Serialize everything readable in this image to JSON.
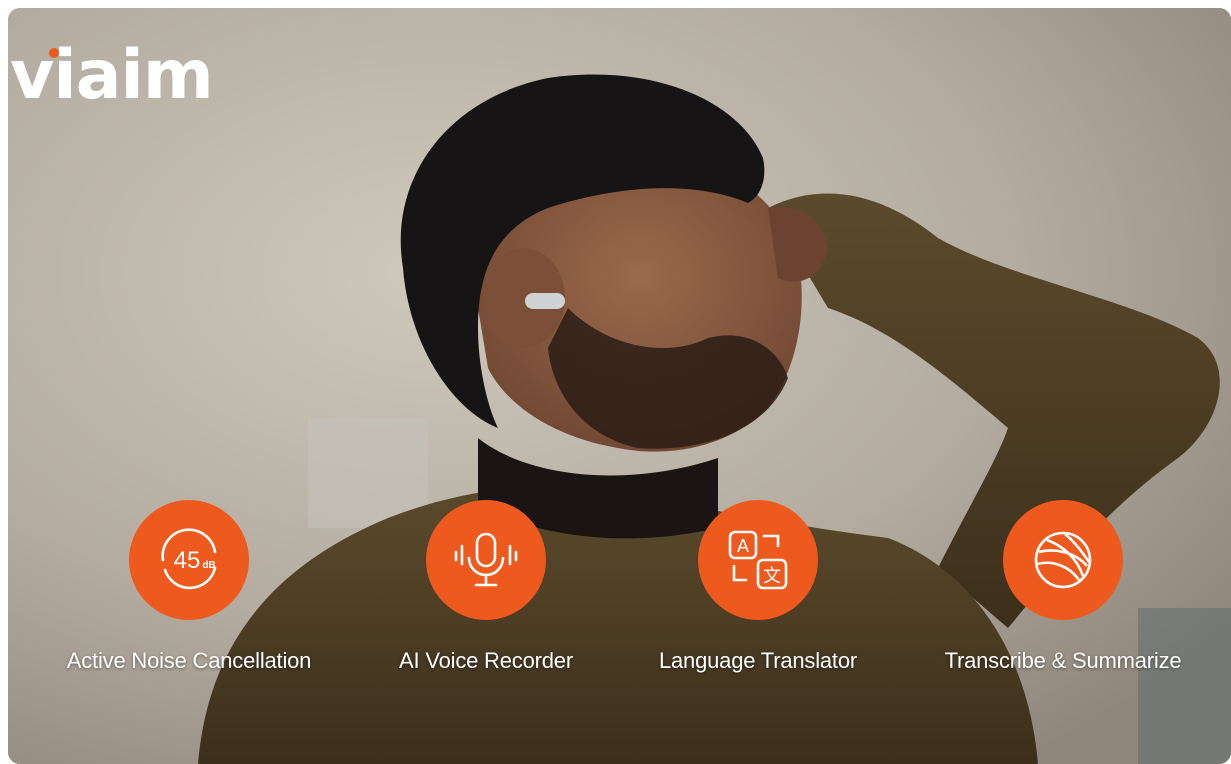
{
  "brand": {
    "logo_text": "viaim",
    "accent_color": "#ee5a1e"
  },
  "features": [
    {
      "label": "Active Noise Cancellation",
      "icon": "noise-cancellation-45db-icon",
      "badge_number": "45",
      "badge_unit": "dB"
    },
    {
      "label": "AI Voice Recorder",
      "icon": "microphone-icon"
    },
    {
      "label": "Language Translator",
      "icon": "translate-icon",
      "glyph_a": "A",
      "glyph_b": "文"
    },
    {
      "label": "Transcribe & Summarize",
      "icon": "yarn-ball-icon"
    }
  ],
  "colors": {
    "icon_circle": "#ee5a1e",
    "text": "#ffffff"
  }
}
